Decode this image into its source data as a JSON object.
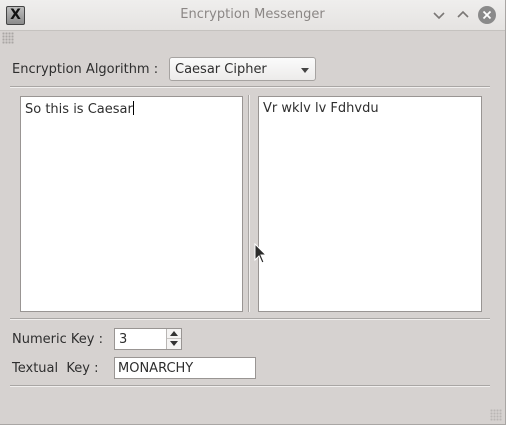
{
  "window": {
    "title": "Encryption Messenger",
    "app_icon_glyph": "X",
    "icons": {
      "app": "x-window-app-icon",
      "minimize": "chevron-down-icon",
      "maximize": "chevron-up-icon",
      "close": "close-icon"
    }
  },
  "algorithm": {
    "label": "Encryption Algorithm :",
    "selected": "Caesar Cipher"
  },
  "input_text": "So this is Caesar",
  "output_text": "Vr wklv lv Fdhvdu",
  "numeric_key": {
    "label": "Numeric Key :",
    "value": "3"
  },
  "textual_key": {
    "label": "Textual  Key :",
    "value": "MONARCHY"
  },
  "colors": {
    "window_bg": "#d6d2d0",
    "titlebar_bg": "#e5e3e1",
    "title_text": "#8b8785",
    "close_button": "#8a8a8a"
  }
}
